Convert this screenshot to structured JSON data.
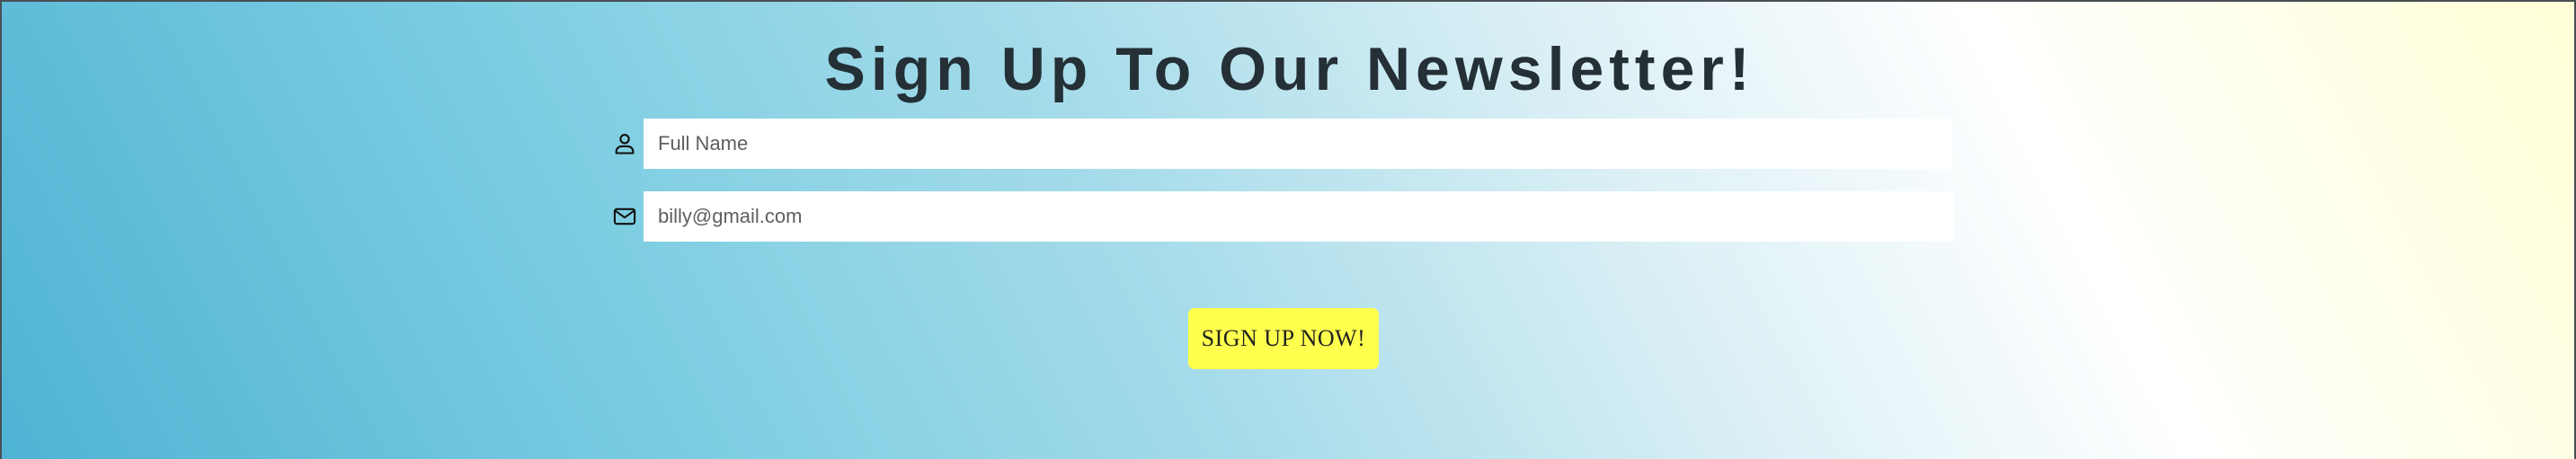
{
  "page": {
    "title": "Sign Up To Our Newsletter!"
  },
  "form": {
    "name_field": {
      "icon": "user-icon",
      "placeholder": "Full Name",
      "value": ""
    },
    "email_field": {
      "icon": "envelope-icon",
      "placeholder": "billy@gmail.com",
      "value": ""
    },
    "submit_label": "SIGN UP NOW!"
  },
  "colors": {
    "gradient_start": "#4fb3d3",
    "gradient_end": "#ffffd6",
    "title_text": "#243036",
    "button_bg": "#ffff4d"
  }
}
